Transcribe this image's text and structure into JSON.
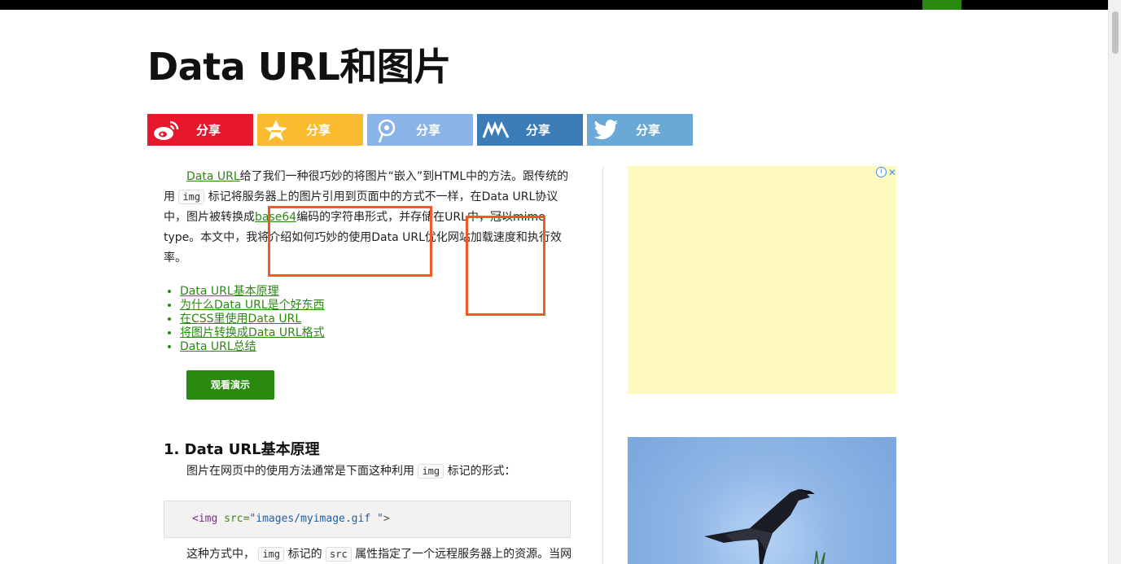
{
  "page": {
    "title": "Data URL和图片"
  },
  "share": {
    "buttons": [
      {
        "label": "分享",
        "icon": "weibo-icon",
        "color": "#e6162d"
      },
      {
        "label": "分享",
        "icon": "qzone-star-icon",
        "color": "#fbbb2e"
      },
      {
        "label": "分享",
        "icon": "tencent-weibo-icon",
        "color": "#8ab3e8"
      },
      {
        "label": "分享",
        "icon": "renren-icon",
        "color": "#3c7db8"
      },
      {
        "label": "分享",
        "icon": "twitter-bird-icon",
        "color": "#6aa9d6"
      }
    ]
  },
  "article": {
    "intro": {
      "link1": "Data URL",
      "text1": "给了我们一种很巧妙的将图片“嵌入”到HTML中的方法。跟传统的用",
      "code1": "img",
      "text2": "标记将服务器上的图片引用到页面中的方式不一样，在Data URL协议中，图片被转换成",
      "link2": "base64",
      "text3": "编码的字符串形式，并存储在URL中，冠以mime type。本文中，我将介绍如何巧妙的使用Data URL优化网站加载速度和执行效率。"
    },
    "toc": [
      "Data URL基本原理",
      "为什么Data URL是个好东西",
      "在CSS里使用Data URL",
      "将图片转换成Data URL格式",
      "Data URL总结"
    ],
    "demo_button": "观看演示",
    "section1": {
      "heading": "1. Data URL基本原理",
      "text_before": "图片在网页中的使用方法通常是下面这种利用",
      "code": "img",
      "text_after": "标记的形式："
    },
    "code_sample": {
      "tag": "<img",
      "attr": "src=",
      "value": "\"images/myimage.gif \"",
      "close": ">"
    },
    "para2": {
      "text1": "这种方式中，",
      "code1": "img",
      "text2": "标记的",
      "code2": "src",
      "text3": "属性指定了一个远程服务器上的资源。当网"
    }
  },
  "ad": {
    "info_label": "i",
    "close_label": "✕"
  },
  "colors": {
    "accent_green": "#2a8a10",
    "highlight_orange": "#f15a24",
    "ad_background": "#fffac0"
  }
}
